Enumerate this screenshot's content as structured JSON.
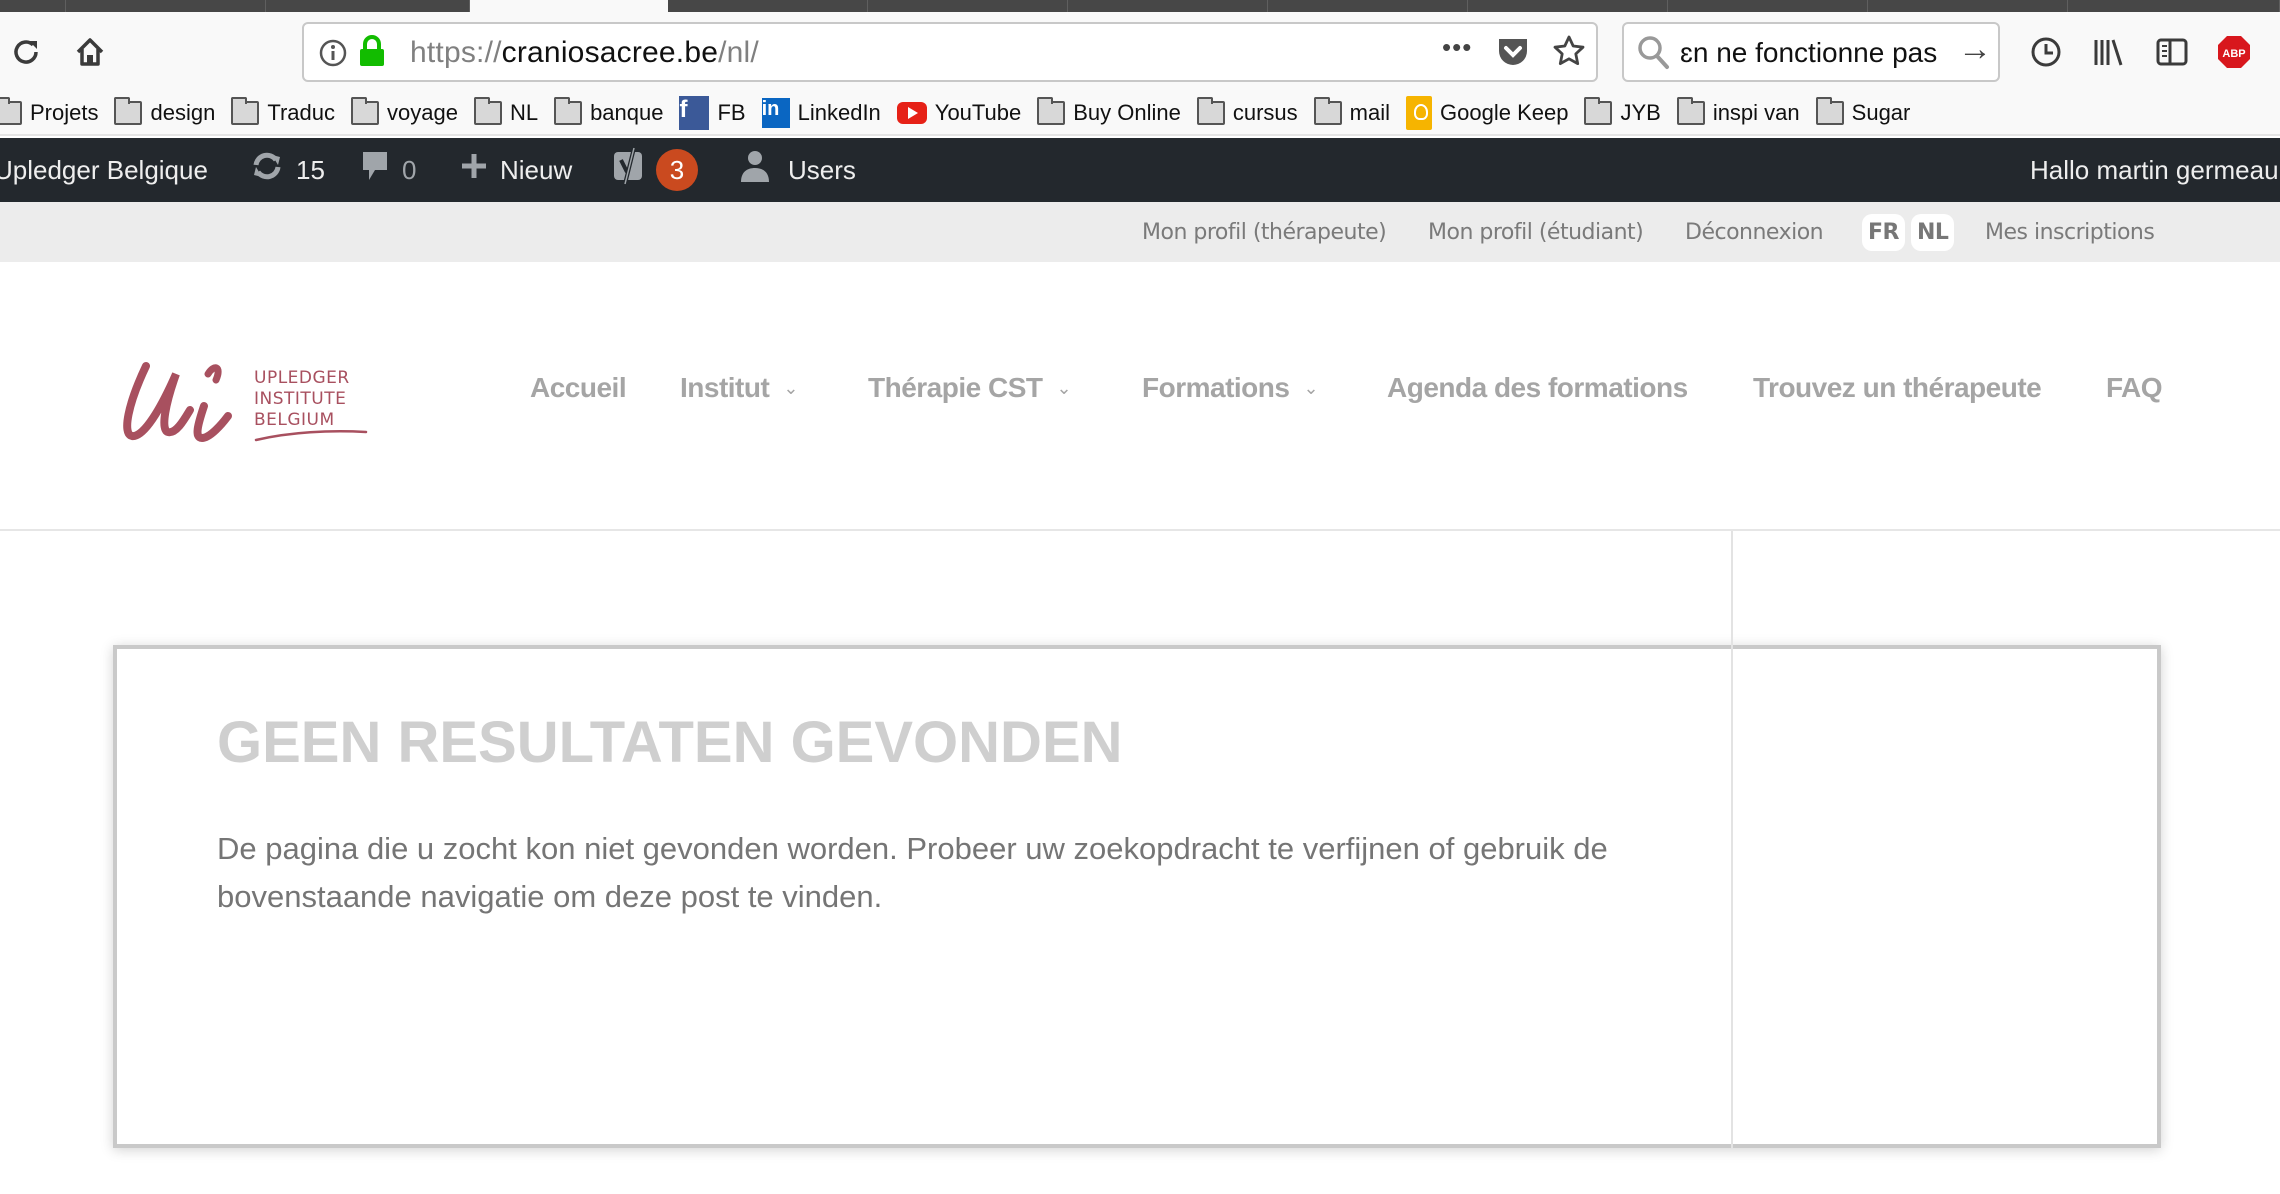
{
  "browser": {
    "tabs": [
      {
        "active": false
      },
      {
        "active": false
      },
      {
        "active": false
      },
      {
        "active": true
      },
      {
        "active": false
      },
      {
        "active": false
      },
      {
        "active": false
      },
      {
        "active": false
      },
      {
        "active": false
      },
      {
        "active": false
      },
      {
        "active": false
      },
      {
        "active": false
      }
    ],
    "toolbar": {
      "reload_icon": "reload-icon",
      "home_icon": "home-icon",
      "url_prefix": "https://",
      "url_host": "craniosacree.be",
      "url_path": "/nl/",
      "page_actions_icon": "•••",
      "search_value": "ɛn ne fonctionne pas",
      "search_go_icon": "→"
    },
    "bookmarks": [
      {
        "label": "Projets",
        "icon": "folder"
      },
      {
        "label": "design",
        "icon": "folder"
      },
      {
        "label": "Traduc",
        "icon": "folder"
      },
      {
        "label": "voyage",
        "icon": "folder"
      },
      {
        "label": "NL",
        "icon": "folder"
      },
      {
        "label": "banque",
        "icon": "folder"
      },
      {
        "label": "FB",
        "icon": "facebook"
      },
      {
        "label": "LinkedIn",
        "icon": "linkedin"
      },
      {
        "label": "YouTube",
        "icon": "youtube"
      },
      {
        "label": "Buy Online",
        "icon": "folder"
      },
      {
        "label": "cursus",
        "icon": "folder"
      },
      {
        "label": "mail",
        "icon": "folder"
      },
      {
        "label": "Google Keep",
        "icon": "google-keep"
      },
      {
        "label": "JYB",
        "icon": "folder"
      },
      {
        "label": "inspi van",
        "icon": "folder"
      },
      {
        "label": "Sugar",
        "icon": "folder"
      }
    ]
  },
  "adminbar": {
    "site_name": "Upledger Belgique",
    "updates_count": "15",
    "comments_count": "0",
    "new_label": "Nieuw",
    "yoast_badge": "3",
    "users_label": "Users",
    "greeting": "Hallo martin germeau"
  },
  "topbar": {
    "links": [
      "Mon profil (thérapeute)",
      "Mon profil (étudiant)",
      "Déconnexion"
    ],
    "languages": [
      "FR",
      "NL"
    ],
    "registrations": "Mes inscriptions"
  },
  "header": {
    "logo": {
      "monogram": "Ui",
      "line1": "UPLEDGER",
      "line2": "INSTITUTE",
      "line3": "BELGIUM"
    },
    "nav": [
      {
        "label": "Accueil",
        "has_dropdown": false
      },
      {
        "label": "Institut",
        "has_dropdown": true
      },
      {
        "label": "Thérapie CST",
        "has_dropdown": true
      },
      {
        "label": "Formations",
        "has_dropdown": true
      },
      {
        "label": "Agenda des formations",
        "has_dropdown": false
      },
      {
        "label": "Trouvez un thérapeute",
        "has_dropdown": false
      },
      {
        "label": "FAQ",
        "has_dropdown": false
      }
    ]
  },
  "content": {
    "title": "GEEN RESULTATEN GEVONDEN",
    "message": "De pagina die u zocht kon niet gevonden worden. Probeer uw zoekopdracht te verfijnen of gebruik de bovenstaande navigatie om deze post te vinden."
  },
  "colors": {
    "brand": "#a8505f",
    "adminbar_bg": "#23282d",
    "badge": "#ca4a1f",
    "nav_text": "#a5a5a5",
    "title_text": "#cfcfcf",
    "body_text": "#757575"
  }
}
